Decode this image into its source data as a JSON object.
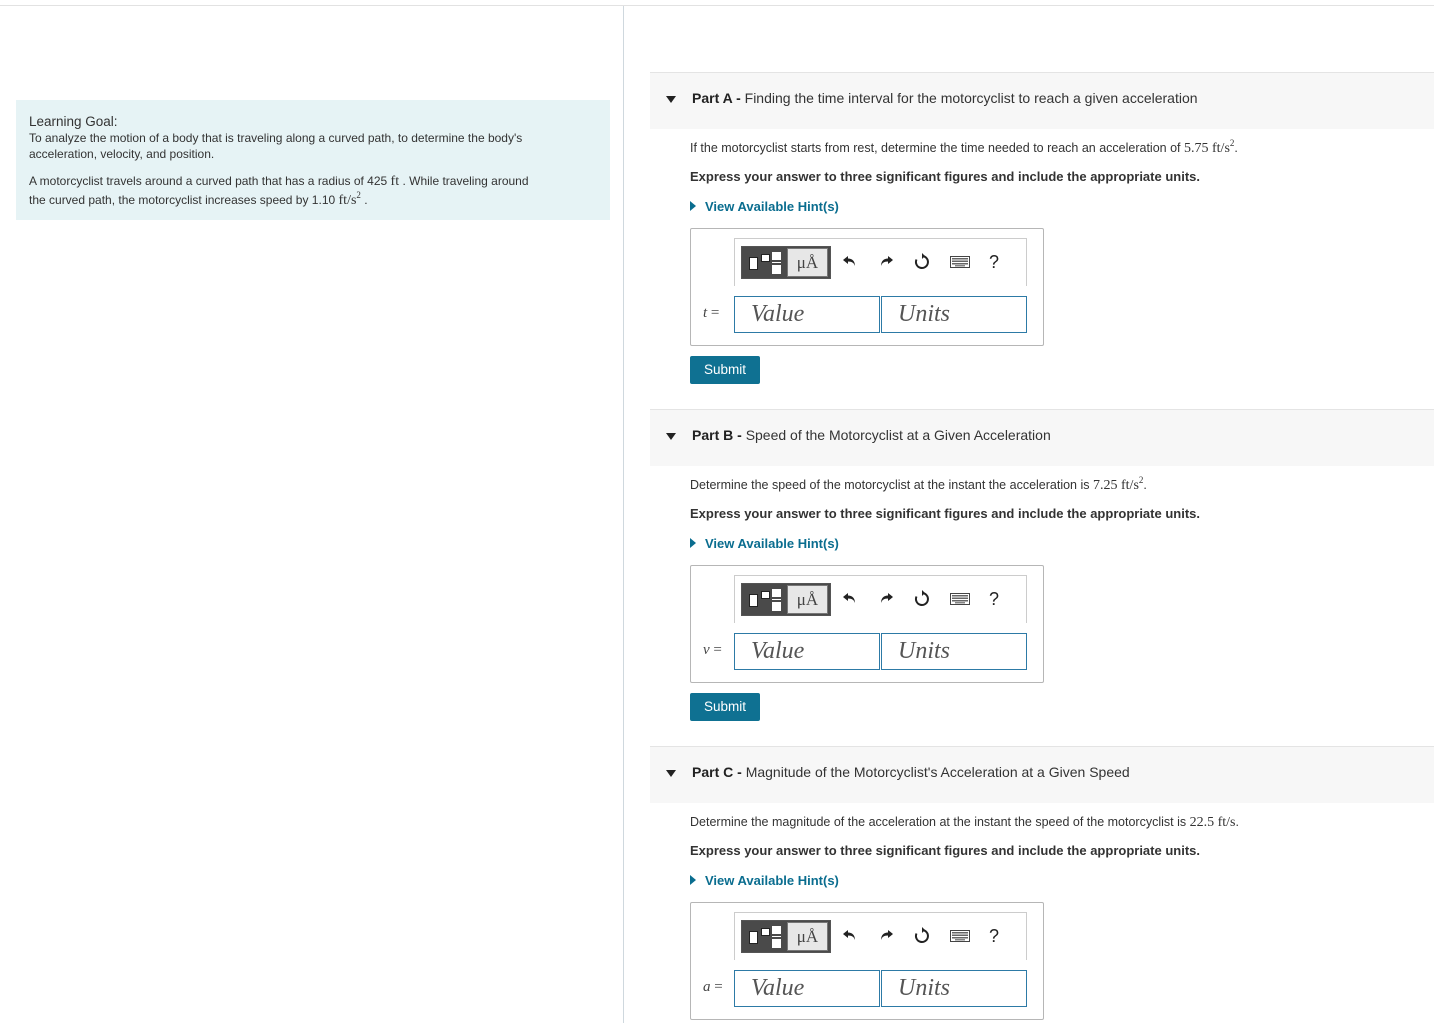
{
  "intro": {
    "goal_title": "Learning Goal:",
    "goal_text_1": "To analyze the motion of a body that is traveling along a curved path, to determine the body's",
    "goal_text_2": "acceleration, velocity, and position.",
    "problem_1a": "A motorcyclist travels around a curved path that has a radius of 425",
    "problem_1_unit": "ft",
    "problem_1b": ". While traveling around",
    "problem_2a": "the curved path, the motorcyclist increases speed by 1.10",
    "problem_2_unit": "ft/s",
    "problem_2_exp": "2",
    "problem_2b": "."
  },
  "toolbar": {
    "units_symbol": "μÅ",
    "help": "?"
  },
  "parts": [
    {
      "letter": "Part A -",
      "title": "Finding the time interval for the motorcyclist to reach a given acceleration",
      "question": "If the motorcyclist starts from rest, determine the time needed to reach an acceleration of",
      "question_value": "5.75 ft/s",
      "question_exp": "2",
      "question_end": ".",
      "instruction": "Express your answer to three significant figures and include the appropriate units.",
      "hint": "View Available Hint(s)",
      "variable": "t",
      "eq": "=",
      "value_placeholder": "Value",
      "units_placeholder": "Units",
      "submit": "Submit"
    },
    {
      "letter": "Part B -",
      "title": "Speed of the Motorcyclist at a Given Acceleration",
      "question": "Determine the speed of the motorcyclist at the instant the acceleration is",
      "question_value": "7.25 ft/s",
      "question_exp": "2",
      "question_end": ".",
      "instruction": "Express your answer to three significant figures and include the appropriate units.",
      "hint": "View Available Hint(s)",
      "variable": "v",
      "eq": "=",
      "value_placeholder": "Value",
      "units_placeholder": "Units",
      "submit": "Submit"
    },
    {
      "letter": "Part C -",
      "title": "Magnitude of the Motorcyclist's Acceleration at a Given Speed",
      "question": "Determine the magnitude of the acceleration at the instant the speed of the motorcyclist is",
      "question_value": "22.5 ft/s",
      "question_exp": "",
      "question_end": ".",
      "instruction": "Express your answer to three significant figures and include the appropriate units.",
      "hint": "View Available Hint(s)",
      "variable": "a",
      "eq": "=",
      "value_placeholder": "Value",
      "units_placeholder": "Units",
      "submit": ""
    }
  ]
}
